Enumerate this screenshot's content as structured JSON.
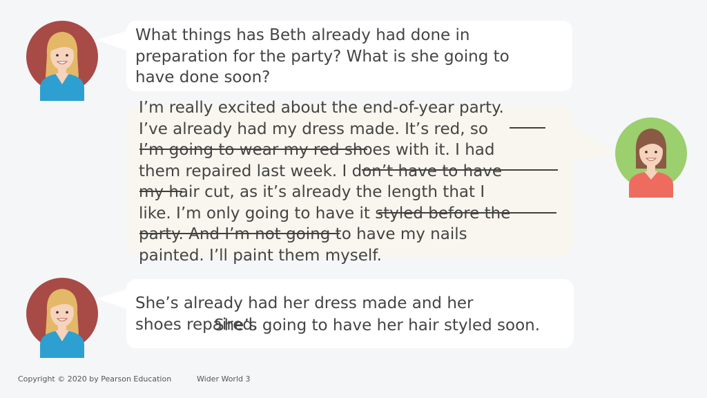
{
  "slide": {
    "question": {
      "lines": [
        "What things has Beth already had done in",
        "preparation for the party? What is she going to",
        "have done soon?"
      ]
    },
    "beth": {
      "lines": [
        "I’m really excited about the end-of-year party.",
        "I’ve already had my dress made. It’s red, so",
        "I’m going to wear my red shoes with it. I had",
        "them repaired last week. I don’t have to have",
        "my hair cut, as it’s already the length that I",
        "like. I’m only going to have it styled before the",
        "party. And I’m not going to have my nails",
        "painted. I’ll paint them myself."
      ]
    },
    "answer": {
      "line1": "She’s already had her dress made and her",
      "line2a": "shoes repaired.",
      "line2b": "She’s going to have her hair styled soon."
    }
  },
  "footer": {
    "copyright": "Copyright © 2020 by Pearson Education",
    "book": "Wider World 3"
  },
  "colors": {
    "background": "#f5f6f8",
    "bubble": "#ffffff",
    "bubble_alt": "#f9f6ef",
    "teacher_avatar_bg": "#a84a46",
    "teacher_shirt": "#2e9fd1",
    "beth_avatar_bg": "#9ccf6d",
    "beth_shirt": "#ee6c5f",
    "text": "#444444"
  },
  "icons": [
    "teacher-avatar-icon",
    "beth-avatar-icon"
  ]
}
